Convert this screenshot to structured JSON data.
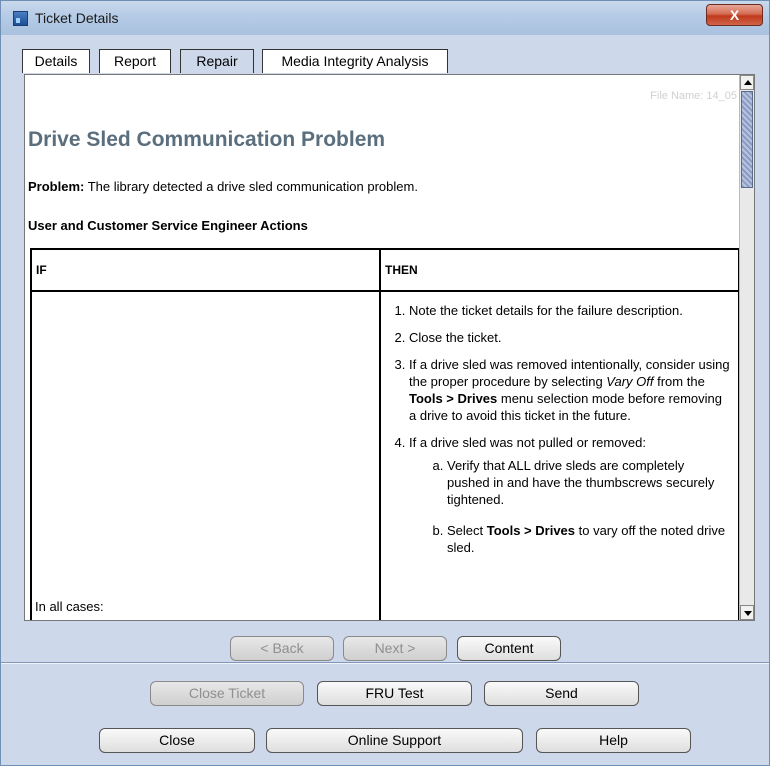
{
  "window": {
    "title": "Ticket Details",
    "close_glyph": "X"
  },
  "tabs": [
    {
      "label": "Details"
    },
    {
      "label": "Report"
    },
    {
      "label": "Repair"
    },
    {
      "label": "Media Integrity Analysis"
    }
  ],
  "active_tab": "Repair",
  "document": {
    "file_name": "File Name: 14_05",
    "title": "Drive Sled Communication Problem",
    "problem_label": "Problem:",
    "problem_text": " The library detected a drive sled communication problem.",
    "actions_heading": "User and Customer Service Engineer Actions",
    "table": {
      "header_if": "IF",
      "header_then": "THEN",
      "if_text": "In all cases:",
      "steps": {
        "s1": "Note the ticket details for the failure description.",
        "s2": "Close the ticket.",
        "s3_a": "If a drive sled was removed intentionally, consider using the proper procedure by selecting ",
        "s3_italic": "Vary Off",
        "s3_b": " from the ",
        "s3_bold": "Tools > Drives",
        "s3_c": " menu selection mode before removing a drive to avoid this ticket in the future.",
        "s4": "If a drive sled was not pulled or removed:",
        "s4a": "Verify that ALL drive sleds are completely pushed in and have the thumbscrews securely tightened.",
        "s4b_a": "Select ",
        "s4b_bold": "Tools > Drives",
        "s4b_b": " to vary off the noted drive sled."
      }
    }
  },
  "nav_buttons": {
    "back": "< Back",
    "next": "Next >",
    "content": "Content"
  },
  "action_buttons": {
    "close_ticket": "Close Ticket",
    "fru_test": "FRU Test",
    "send": "Send"
  },
  "bottom_buttons": {
    "close": "Close",
    "online_support": "Online Support",
    "help": "Help"
  }
}
